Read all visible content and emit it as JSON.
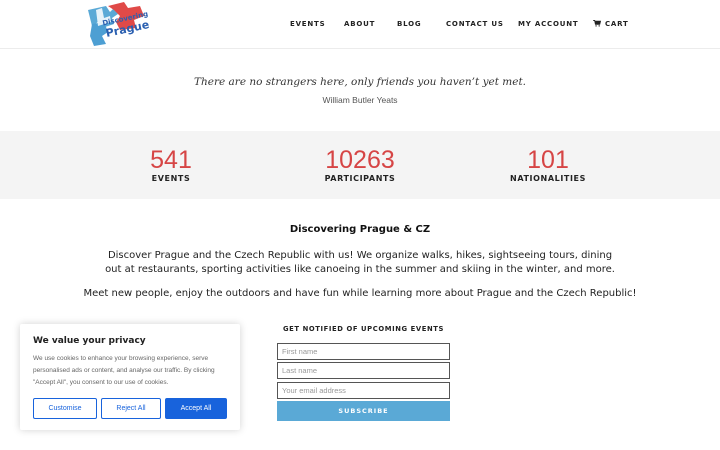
{
  "brand": {
    "logo_small_text": "Discovering",
    "logo_big_text": "Prague",
    "colors": {
      "logo_red": "#e04a48",
      "logo_blue": "#2a5fb0",
      "accent": "#d64545"
    }
  },
  "nav": {
    "items": [
      "EVENTS",
      "ABOUT",
      "BLOG",
      "CONTACT US",
      "MY ACCOUNT"
    ],
    "cart_label": "CART",
    "cart_icon": "cart-icon"
  },
  "quote": {
    "text": "There are no strangers here, only friends you haven’t yet met.",
    "author": "William Butler Yeats"
  },
  "stats": [
    {
      "value": "541",
      "label": "EVENTS"
    },
    {
      "value": "10263",
      "label": "PARTICIPANTS"
    },
    {
      "value": "101",
      "label": "NATIONALITIES"
    }
  ],
  "about": {
    "title": "Discovering Prague & CZ",
    "paragraph1": "Discover Prague and the Czech Republic with us! We organize walks, hikes, sightseeing tours, dining out at restaurants, sporting activities like canoeing in the summer and skiing in the winter, and more.",
    "paragraph2": "Meet new people, enjoy the outdoors and have fun while learning more about Prague and the Czech Republic!"
  },
  "newsletter": {
    "title": "GET NOTIFIED OF UPCOMING EVENTS",
    "first_name_placeholder": "First name",
    "last_name_placeholder": "Last name",
    "email_placeholder": "Your email address",
    "subscribe_label": "SUBSCRIBE",
    "button_color": "#5aa9d6"
  },
  "cookie": {
    "title": "We value your privacy",
    "text": "We use cookies to enhance your browsing experience, serve personalised ads or content, and analyse our traffic. By clicking \"Accept All\", you consent to our use of cookies.",
    "customise_label": "Customise",
    "reject_label": "Reject All",
    "accept_label": "Accept All",
    "button_color": "#1863dc"
  }
}
